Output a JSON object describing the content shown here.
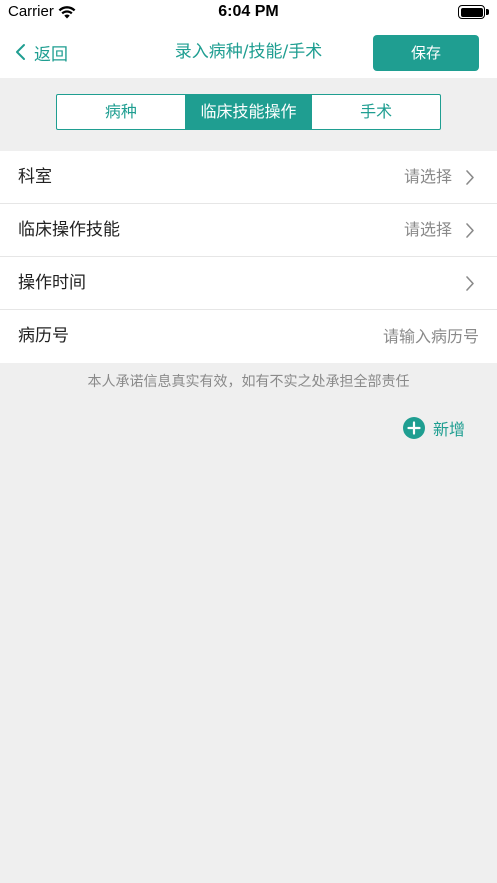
{
  "status_bar": {
    "carrier": "Carrier",
    "time": "6:04 PM",
    "icons": [
      "wifi-icon",
      "battery-icon"
    ]
  },
  "nav": {
    "back_label": "返回",
    "title": "录入病种/技能/手术",
    "save_label": "保存",
    "back_icon": "chevron-left-icon"
  },
  "tabs": [
    {
      "label": "病种",
      "active": false
    },
    {
      "label": "临床技能操作",
      "active": true
    },
    {
      "label": "手术",
      "active": false
    }
  ],
  "form": {
    "department": {
      "label": "科室",
      "value": "请选择"
    },
    "skill": {
      "label": "临床操作技能",
      "value": "请选择"
    },
    "operation_time": {
      "label": "操作时间",
      "value": ""
    },
    "record_number": {
      "label": "病历号",
      "placeholder": "请输入病历号",
      "value": ""
    }
  },
  "notice": "本人承诺信息真实有效，如有不实之处承担全部责任",
  "add": {
    "label": "新增",
    "icon": "plus-circle-icon"
  },
  "colors": {
    "accent": "#1f9e91",
    "background": "#efefef",
    "muted_text": "#8a8a8a"
  }
}
